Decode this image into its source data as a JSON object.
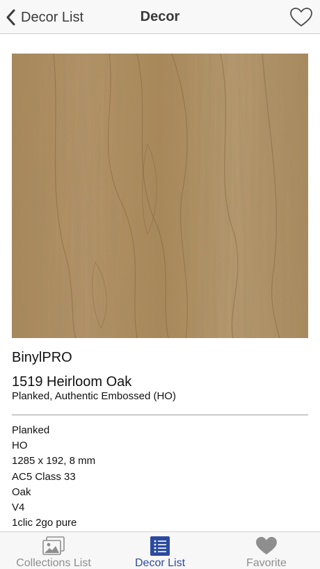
{
  "nav": {
    "back_label": "Decor List",
    "title": "Decor"
  },
  "icons": {
    "back": "chevron-left-icon",
    "favorite": "heart-outline-icon",
    "collections": "photos-icon",
    "decor_list": "list-icon",
    "favorite_tab": "heart-filled-icon"
  },
  "carousel": {
    "page_count": 4,
    "current_page": 1
  },
  "product": {
    "brand": "BinylPRO",
    "name": "1519 Heirloom Oak",
    "subtitle": "Planked, Authentic Embossed (HO)",
    "specs": [
      "Planked",
      "HO",
      "1285 x 192, 8 mm",
      "AC5 Class 33",
      "Oak",
      "V4",
      "1clic 2go pure"
    ]
  },
  "tabs": [
    {
      "label": "Collections List",
      "active": false
    },
    {
      "label": "Decor List",
      "active": true
    },
    {
      "label": "Favorite",
      "active": false
    }
  ],
  "colors": {
    "accent": "#2b4aa0",
    "inactive": "#8e8e8e",
    "wood": "#b08f62"
  }
}
